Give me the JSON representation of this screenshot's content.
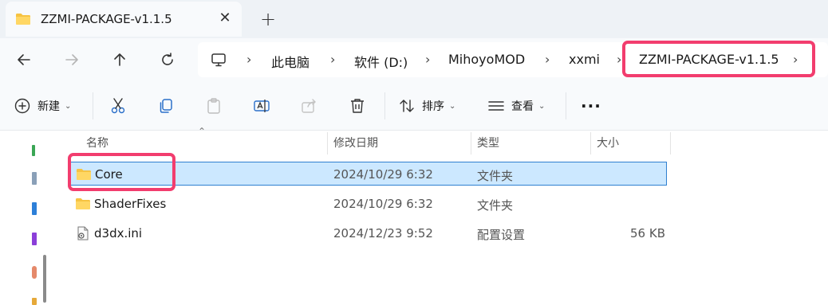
{
  "tab": {
    "title": "ZZMI-PACKAGE-v1.1.5",
    "close": "✕",
    "new_tab": "+"
  },
  "nav": {
    "breadcrumb": [
      "此电脑",
      "软件 (D:)",
      "MihoyoMOD",
      "xxmi",
      "ZZMI-PACKAGE-v1.1.5"
    ],
    "sep": "›"
  },
  "toolbar": {
    "new_label": "新建",
    "sort_label": "排序",
    "view_label": "查看",
    "more_label": "···"
  },
  "columns": {
    "name": "名称",
    "date": "修改日期",
    "type": "类型",
    "size": "大小"
  },
  "files": [
    {
      "name": "Core",
      "date": "2024/10/29 6:32",
      "type": "文件夹",
      "size": "",
      "icon": "folder-icon"
    },
    {
      "name": "ShaderFixes",
      "date": "2024/10/29 6:32",
      "type": "文件夹",
      "size": "",
      "icon": "folder-icon"
    },
    {
      "name": "d3dx.ini",
      "date": "2024/12/23 9:52",
      "type": "配置设置",
      "size": "56 KB",
      "icon": "ini-file-icon"
    }
  ],
  "colors": {
    "highlight": "#f23d6e",
    "selection": "#cce8ff",
    "folder": "#f6c342"
  }
}
